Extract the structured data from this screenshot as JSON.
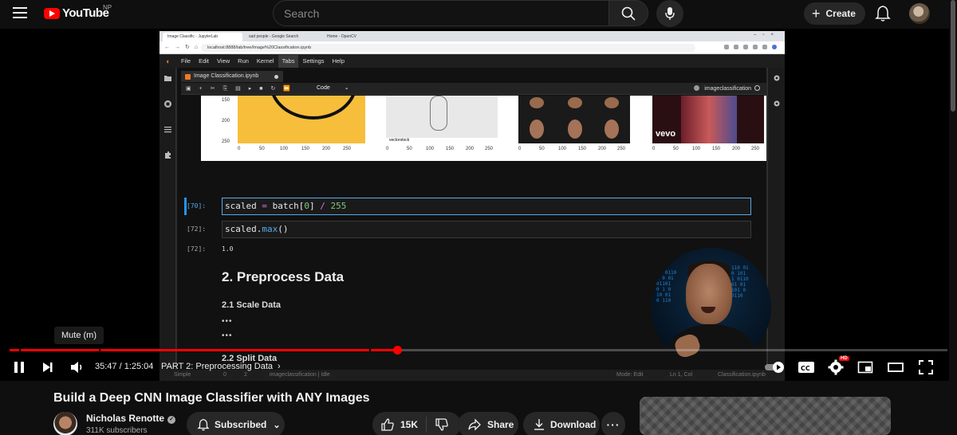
{
  "masthead": {
    "logo_text": "YouTube",
    "region": "NP",
    "search_placeholder": "Search",
    "create_label": "Create"
  },
  "browser": {
    "tabs": [
      "Image Classific - JupyterLab",
      "sad people - Google Search",
      "Home - OpenCV"
    ],
    "address": "localhost:8888/lab/tree/Image%20Classification.ipynb"
  },
  "jupyter": {
    "menu": [
      "File",
      "Edit",
      "View",
      "Run",
      "Kernel",
      "Tabs",
      "Settings",
      "Help"
    ],
    "selected_menu": "Tabs",
    "doc_tab": "Image Classification.ipynb",
    "cell_type": "Code",
    "kernel_name": "imageclassification",
    "y_ticks": [
      "150",
      "200",
      "250"
    ],
    "x_ticks": [
      "0",
      "50",
      "100",
      "150",
      "200",
      "250"
    ],
    "watermark": "vectorstock",
    "vevo": "vevo",
    "cells": {
      "c1_prompt": "[70]:",
      "c1_code_a": "scaled ",
      "c1_code_op": "=",
      "c1_code_b": " batch[",
      "c1_code_num": "0",
      "c1_code_c": "] ",
      "c1_code_op2": "/",
      "c1_code_num2": " 255",
      "c2_prompt": "[72]:",
      "c2_code_a": "scaled.",
      "c2_code_fn": "max",
      "c2_code_b": "()",
      "out_prompt": "[72]:",
      "out_value": "1.0",
      "h2": "2. Preprocess Data",
      "h3_1": "2.1 Scale Data",
      "ellipsis": "•••",
      "h3_2": "2.2 Split Data"
    },
    "status": {
      "mode": "Simple",
      "counts_a": "0",
      "counts_b": "2",
      "kernel_status": "imageclassification | Idle",
      "edit_mode": "Mode: Edit",
      "position": "Ln 1, Col",
      "file": "Classification.ipynb"
    }
  },
  "player": {
    "tooltip": "Mute (m)",
    "time": "35:47 / 1:25:04",
    "chapter": "PART 2: Preprocessing Data",
    "progress_fraction": 0.413,
    "hd_badge": "HD"
  },
  "video_info": {
    "title": "Build a Deep CNN Image Classifier with ANY Images",
    "channel": "Nicholas Renotte",
    "subscribers": "311K subscribers",
    "subscribed_label": "Subscribed",
    "likes": "15K",
    "share_label": "Share",
    "download_label": "Download"
  },
  "colors": {
    "brand_red": "#ff0000",
    "jupyter_orange": "#f37726",
    "active_cell_blue": "#2196f3"
  }
}
